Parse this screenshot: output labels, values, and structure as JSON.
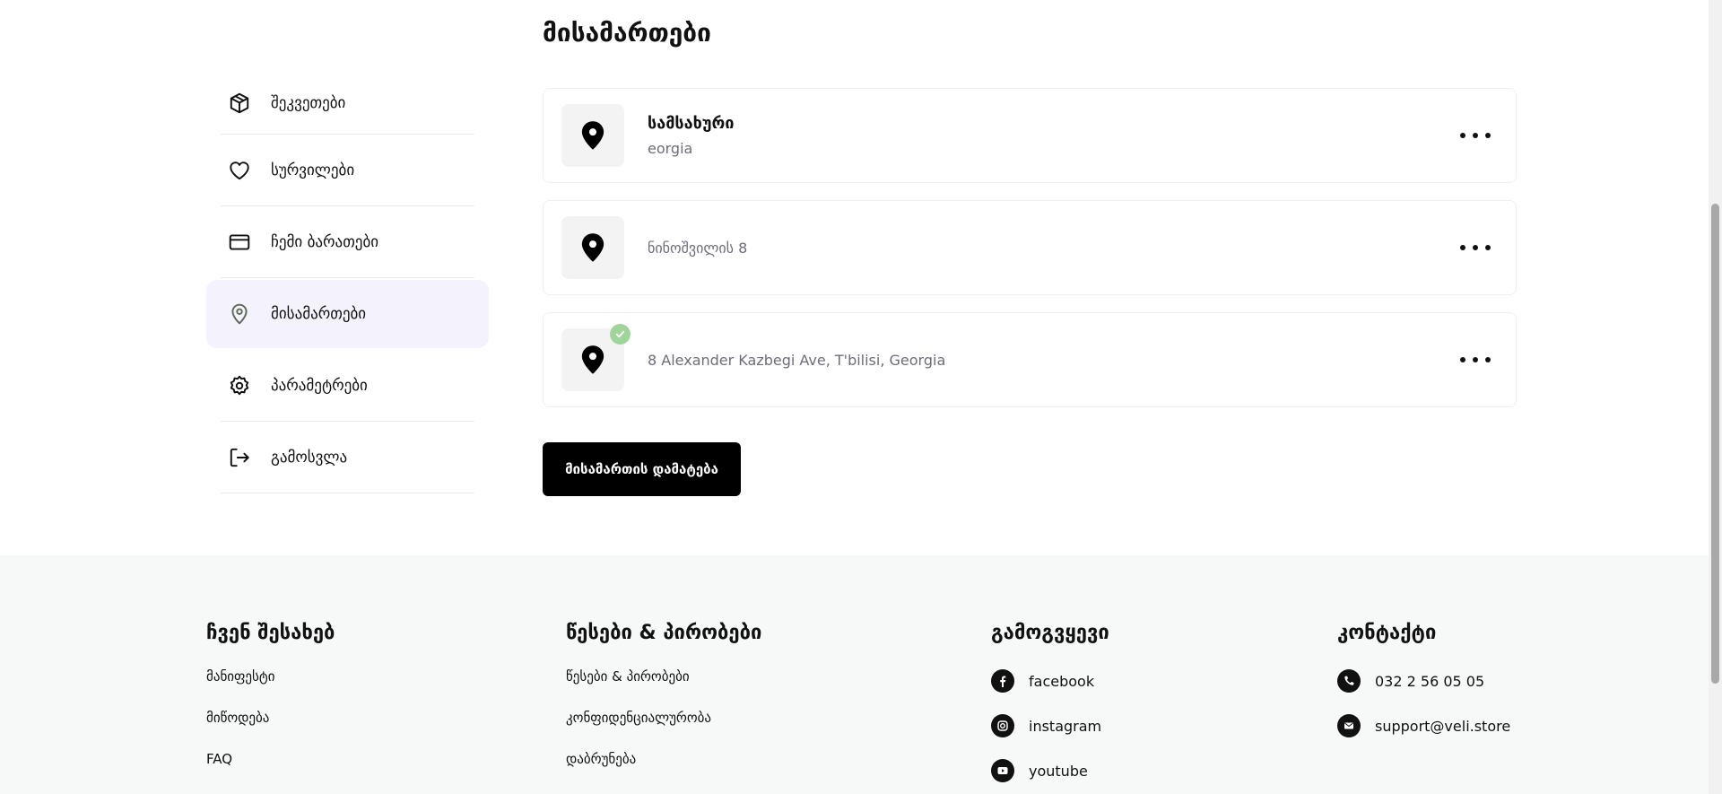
{
  "page": {
    "title": "მისამართები"
  },
  "sidebar": {
    "items": [
      {
        "label": "შეკვეთები",
        "icon": "package-icon",
        "active": false
      },
      {
        "label": "სურვილები",
        "icon": "heart-icon",
        "active": false
      },
      {
        "label": "ჩემი ბარათები",
        "icon": "credit-card-icon",
        "active": false
      },
      {
        "label": "მისამართები",
        "icon": "map-pin-icon",
        "active": true
      },
      {
        "label": "პარამეტრები",
        "icon": "gear-icon",
        "active": false
      },
      {
        "label": "გამოსვლა",
        "icon": "logout-icon",
        "active": false
      }
    ]
  },
  "addresses": [
    {
      "title": "სამსახური",
      "subtitle": "eorgia",
      "default": false
    },
    {
      "title": "",
      "subtitle": "ნინოშვილის 8",
      "default": false
    },
    {
      "title": "",
      "subtitle": "8 Alexander Kazbegi Ave, T'bilisi, Georgia",
      "default": true
    }
  ],
  "add_button": {
    "label": "მისამართის დამატება"
  },
  "footer": {
    "about": {
      "title": "ჩვენ შესახებ",
      "links": [
        "მანიფესტი",
        "მიწოდება",
        "FAQ"
      ]
    },
    "terms": {
      "title": "წესები & პირობები",
      "links": [
        "წესები & პირობები",
        "კონფიდენციალურობა",
        "დაბრუნება"
      ]
    },
    "follow": {
      "title": "გამოგვყევი",
      "links": [
        "facebook",
        "instagram",
        "youtube"
      ]
    },
    "contacts": {
      "title": "კონტაქტი",
      "phone": "032 2 56 05 05",
      "email": "support@veli.store"
    }
  },
  "colors": {
    "active_bg": "#f4f3fd",
    "badge": "#9fd49a",
    "footer_bg": "#f7f8f8",
    "button_bg": "#000000"
  }
}
